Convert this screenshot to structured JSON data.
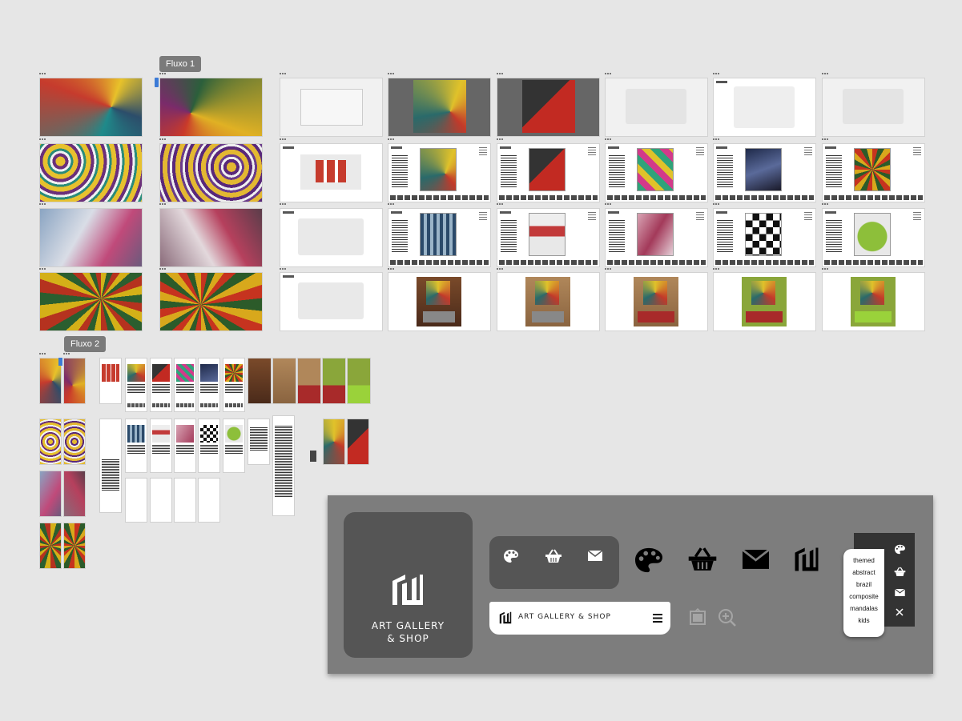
{
  "flows": {
    "flow1_label": "Fluxo 1",
    "flow2_label": "Fluxo 2"
  },
  "style_guide": {
    "brand_name_line1": "ART GALLERY",
    "brand_name_line2": "& SHOP",
    "header_title": "ART GALLERY & SHOP",
    "menu_items": [
      "themed",
      "abstract",
      "brazil",
      "composite",
      "mandalas",
      "kids"
    ],
    "icons": [
      "palette-icon",
      "basket-icon",
      "mail-icon",
      "logo-icon",
      "menu-icon",
      "frame-icon",
      "zoom-in-icon",
      "close-icon"
    ]
  },
  "colors": {
    "panel_bg": "#7d7d7d",
    "card_dark": "#555555",
    "menu_dark": "#333333",
    "canvas_bg": "#e6e6e6"
  }
}
